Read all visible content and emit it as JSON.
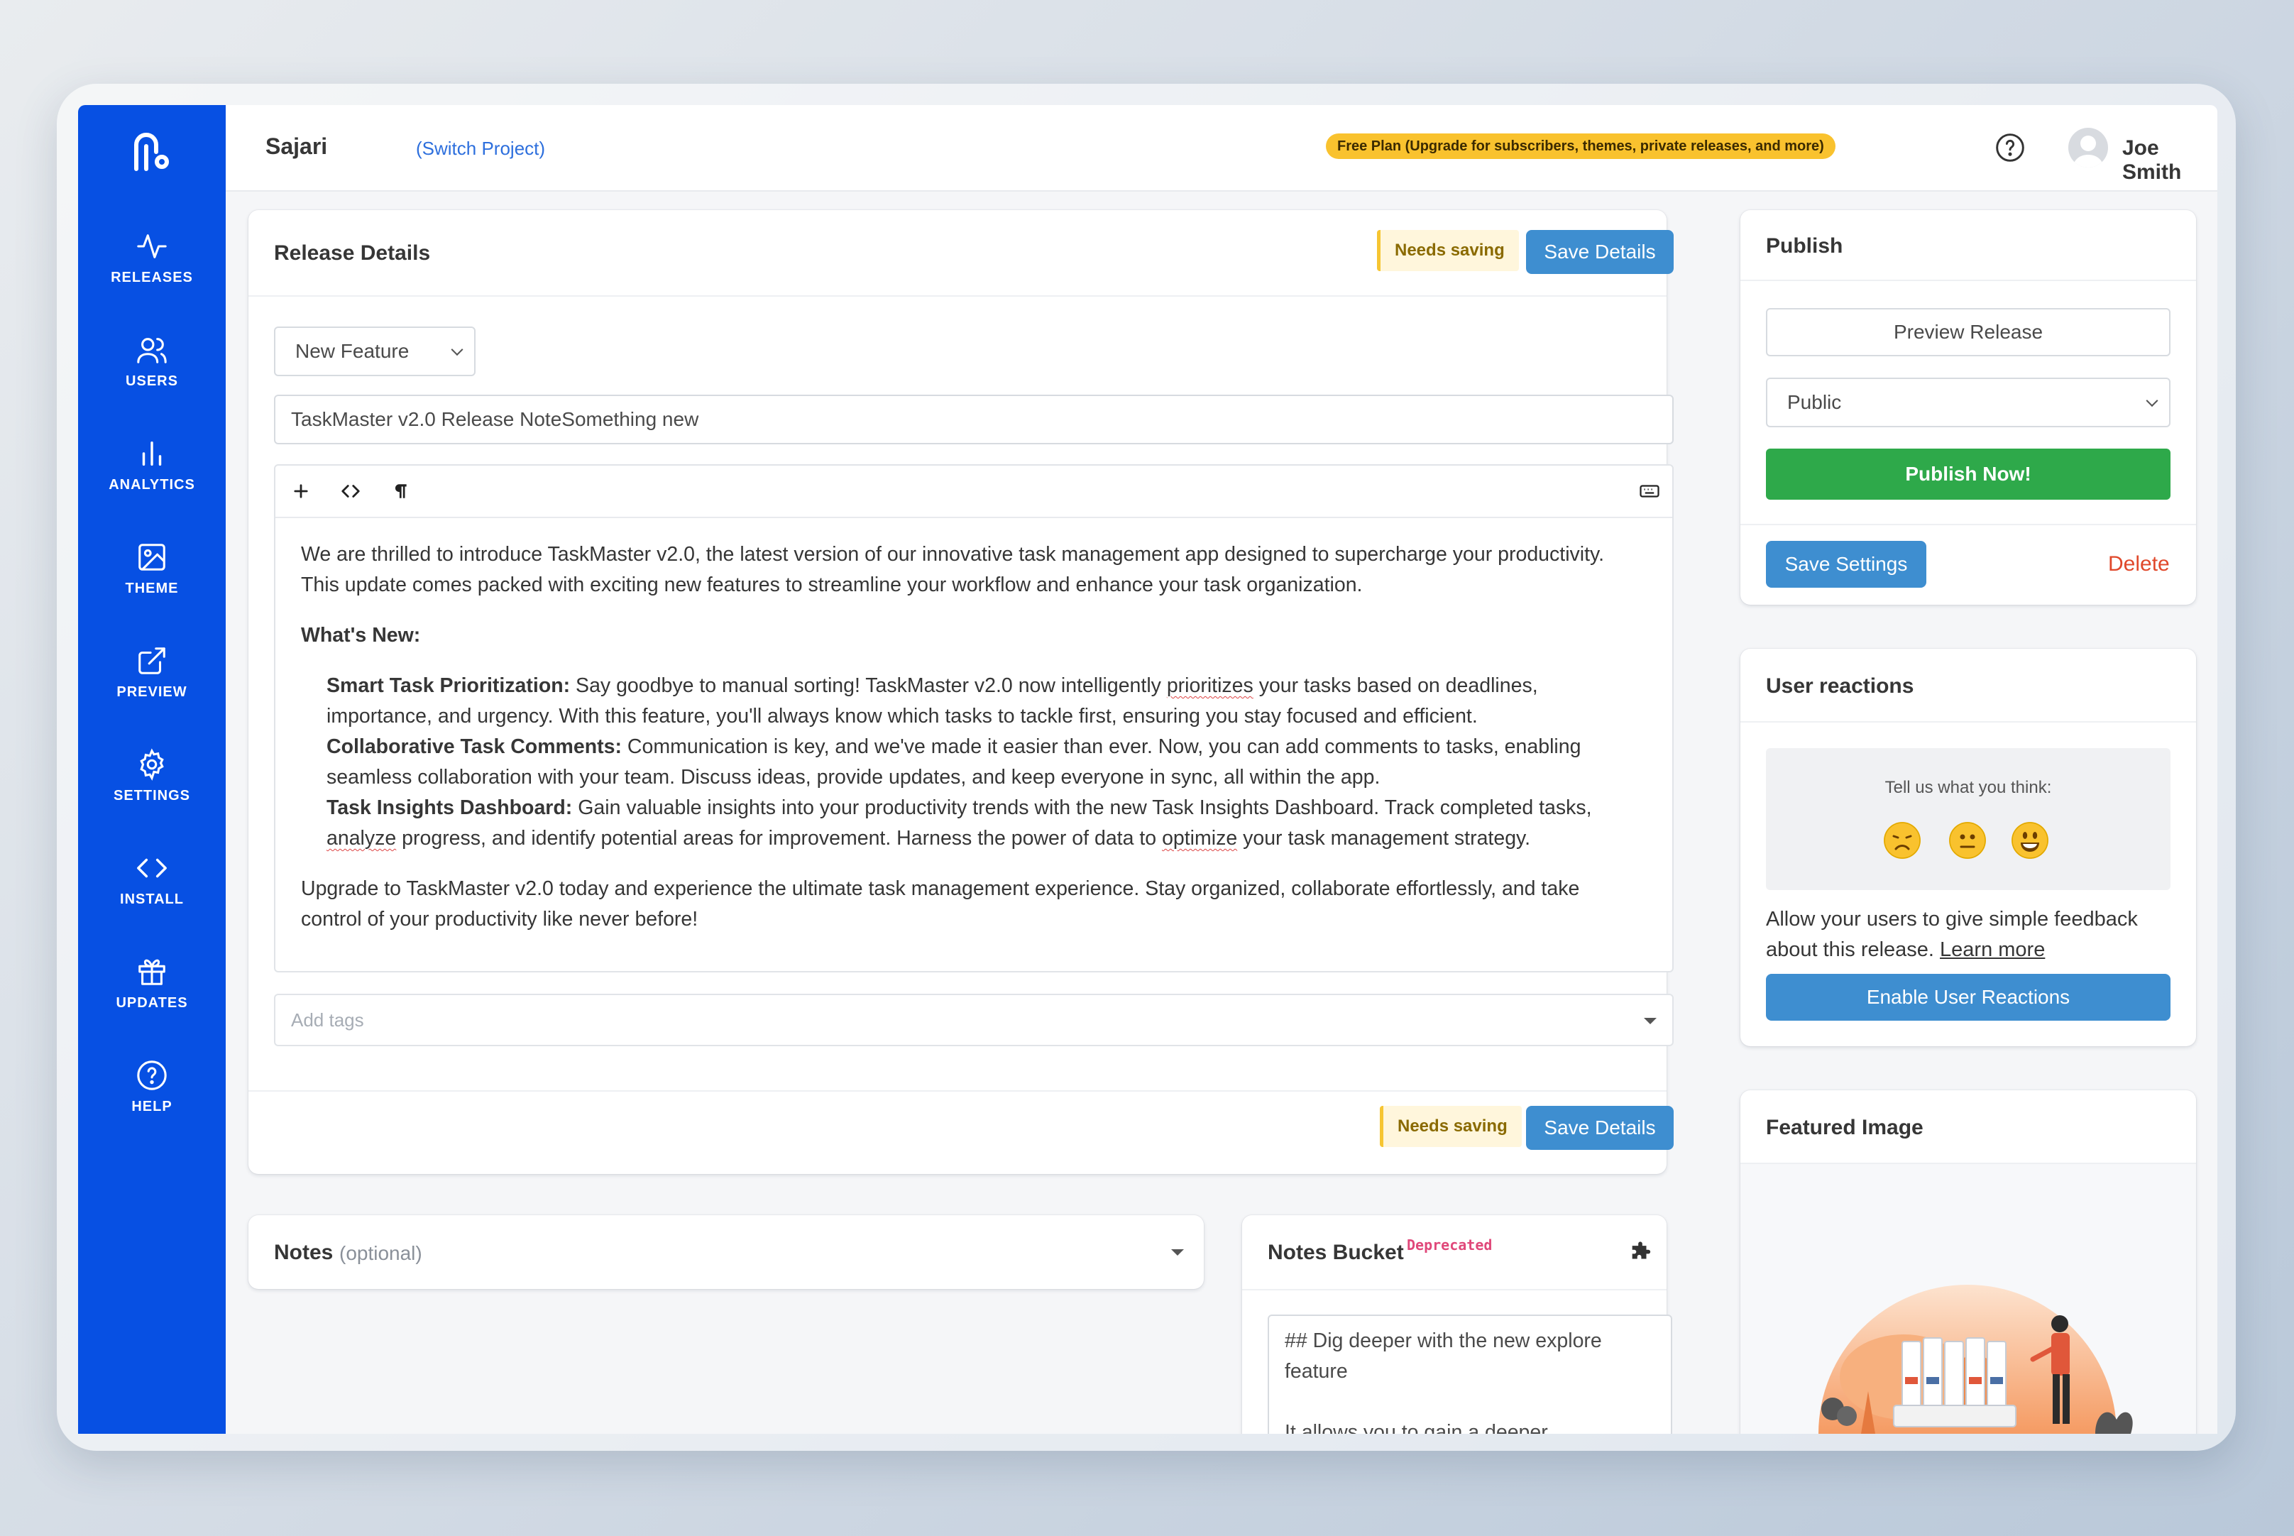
{
  "project": {
    "name": "Sajari",
    "switch_label": "(Switch Project)"
  },
  "plan_banner": "Free Plan (Upgrade for subscribers, themes, private releases, and more)",
  "user": {
    "name": "Joe Smith"
  },
  "sidebar": {
    "items": [
      {
        "label": "RELEASES",
        "icon": "pulse-icon"
      },
      {
        "label": "USERS",
        "icon": "users-icon"
      },
      {
        "label": "ANALYTICS",
        "icon": "bar-chart-icon"
      },
      {
        "label": "THEME",
        "icon": "image-icon"
      },
      {
        "label": "PREVIEW",
        "icon": "external-link-icon"
      },
      {
        "label": "SETTINGS",
        "icon": "gear-icon"
      },
      {
        "label": "INSTALL",
        "icon": "code-icon"
      },
      {
        "label": "UPDATES",
        "icon": "gift-icon"
      },
      {
        "label": "HELP",
        "icon": "help-circle-icon"
      }
    ]
  },
  "release": {
    "title": "Release Details",
    "needs_saving": "Needs saving",
    "save_label": "Save Details",
    "type_value": "New Feature",
    "title_value": "TaskMaster v2.0 Release NoteSomething new",
    "body": {
      "intro": "We are thrilled to introduce TaskMaster v2.0, the latest version of our innovative task management app designed to supercharge your productivity. This update comes packed with exciting new features to streamline your workflow and enhance your task organization.",
      "whats_new": "What's New:",
      "f1_title": "Smart Task Prioritization:",
      "f1_a": " Say goodbye to manual sorting! TaskMaster v2.0 now intelligently ",
      "f1_sq": "prioritizes",
      "f1_b": " your tasks based on deadlines, importance, and urgency. With this feature, you'll always know which tasks to tackle first, ensuring you stay focused and efficient.",
      "f2_title": "Collaborative Task Comments:",
      "f2_text": " Communication is key, and we've made it easier than ever. Now, you can add comments to tasks, enabling seamless collaboration with your team. Discuss ideas, provide updates, and keep everyone in sync, all within the app.",
      "f3_title": "Task Insights Dashboard:",
      "f3_a": " Gain valuable insights into your productivity trends with the new Task Insights Dashboard. Track completed tasks, ",
      "f3_sq1": "analyze",
      "f3_b": " progress, and identify potential areas for improvement. Harness the power of data to ",
      "f3_sq2": "optimize",
      "f3_c": " your task management strategy.",
      "outro": "Upgrade to TaskMaster v2.0 today and experience the ultimate task management experience. Stay organized, collaborate effortlessly, and take control of your productivity like never before!"
    },
    "tags_placeholder": "Add tags"
  },
  "notes": {
    "title": "Notes",
    "optional": "(optional)"
  },
  "notes_bucket": {
    "title": "Notes Bucket",
    "deprecated": "Deprecated",
    "content_line1": "## Dig deeper with the new explore",
    "content_line2": "feature",
    "content_line3": "It allows you to gain a deeper"
  },
  "publish": {
    "title": "Publish",
    "preview_label": "Preview Release",
    "visibility": "Public",
    "publish_label": "Publish Now!",
    "save_settings": "Save Settings",
    "delete": "Delete"
  },
  "reactions": {
    "title": "User reactions",
    "prompt": "Tell us what you think:",
    "desc_a": "Allow your users to give simple feedback about this release. ",
    "learn_more": "Learn more",
    "enable_label": "Enable User Reactions"
  },
  "featured_image": {
    "title": "Featured Image"
  },
  "colors": {
    "sidebar": "#0750e3",
    "primary": "#3e8ed0",
    "success": "#2ea94a",
    "warning": "#f9c22e",
    "danger": "#e0482b"
  }
}
